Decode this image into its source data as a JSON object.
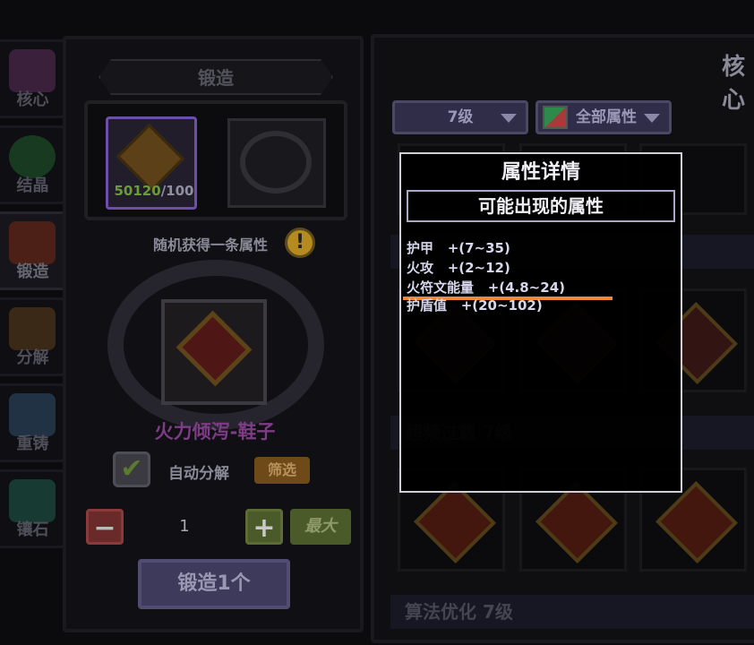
{
  "sidebar": {
    "items": [
      {
        "label": "核心",
        "icon": "core-icon",
        "color": "#6a3a6a"
      },
      {
        "label": "结晶",
        "icon": "crystal-icon",
        "color": "#2a6a3a"
      },
      {
        "label": "锻造",
        "icon": "forge-icon",
        "color": "#8a3a2a",
        "active": true
      },
      {
        "label": "分解",
        "icon": "decompose-icon",
        "color": "#6a4a2a"
      },
      {
        "label": "重铸",
        "icon": "recast-icon",
        "color": "#3a5a7a"
      },
      {
        "label": "镶石",
        "icon": "inlay-icon",
        "color": "#2a6a5a"
      }
    ]
  },
  "forge": {
    "title": "锻造",
    "material_have": "50120",
    "material_need": "/100",
    "random_attr_text": "随机获得一条属性",
    "info_icon": "!",
    "result_name": "火力倾泻-鞋子",
    "auto_decompose_label": "自动分解",
    "auto_decompose_checked": true,
    "filter_label": "筛选",
    "minus": "−",
    "plus": "+",
    "quantity": "1",
    "max_label": "最大",
    "forge_button": "锻造1个"
  },
  "right": {
    "title": "核心",
    "level_filter": "7级",
    "attr_filter": "全部属性",
    "sections": [
      "超频过载 7级",
      "算法优化 7级"
    ]
  },
  "tooltip": {
    "title": "属性详情",
    "subtitle": "可能出现的属性",
    "attributes": [
      {
        "name": "护甲",
        "range": "+(7~35)"
      },
      {
        "name": "火攻",
        "range": "+(2~12)"
      },
      {
        "name": "火符文能量",
        "range": "+(4.8~24)"
      },
      {
        "name": "护盾值",
        "range": "+(20~102)"
      }
    ]
  },
  "colors": {
    "highlight_underline": "#f08838",
    "purple_frame": "#6b4fa8",
    "result_name": "#7d3d86"
  }
}
